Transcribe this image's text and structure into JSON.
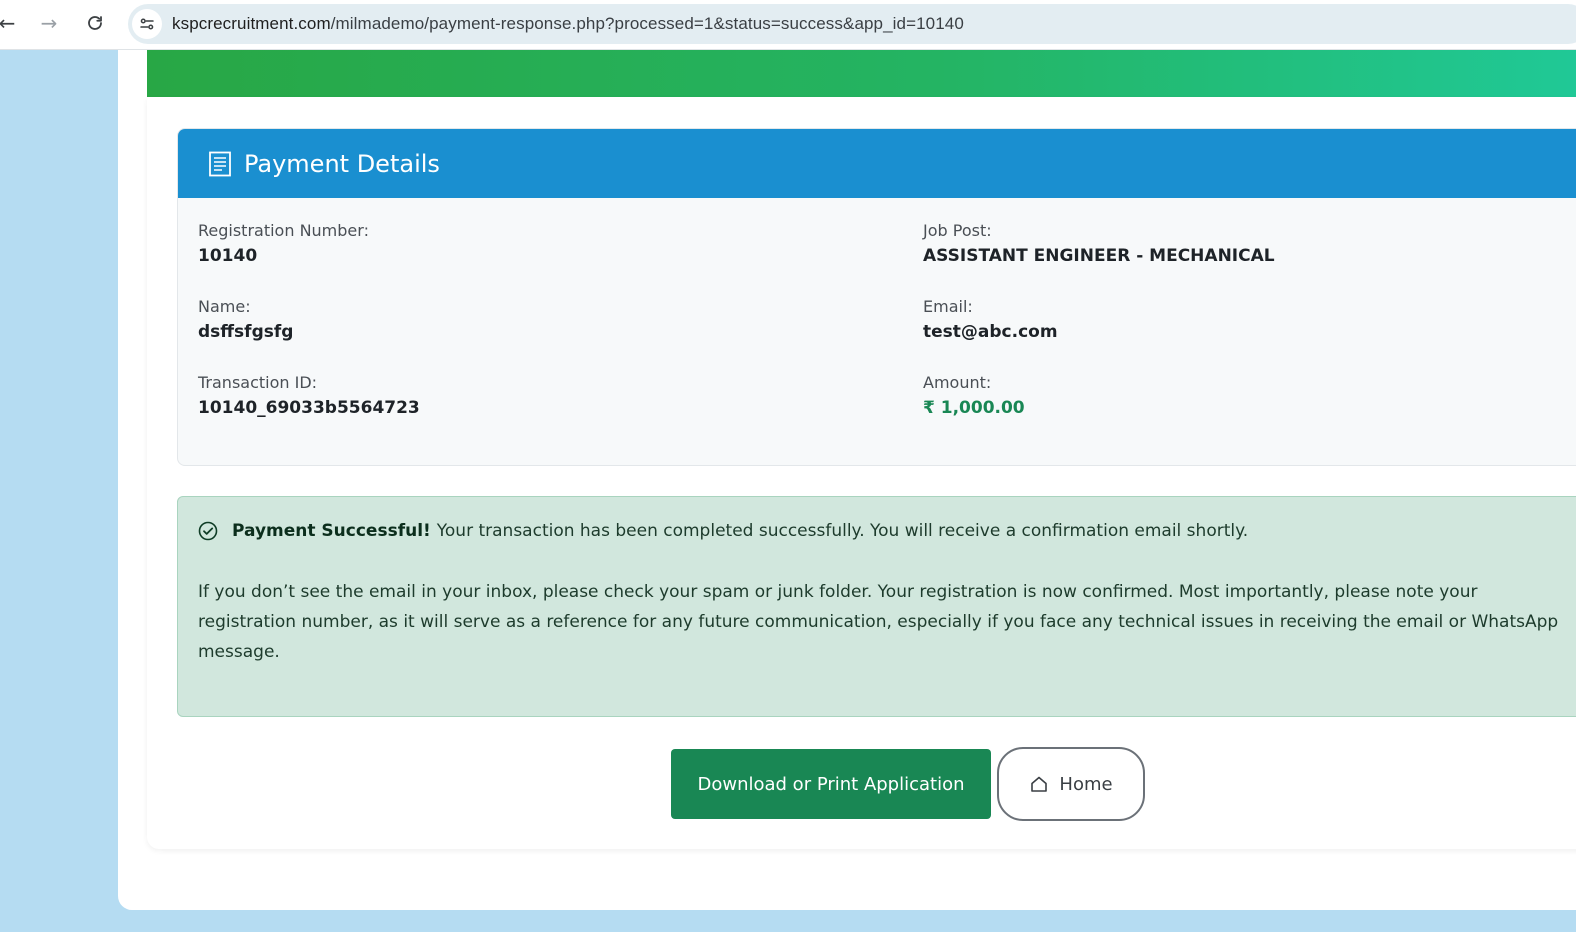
{
  "browser": {
    "url_host": "kspcrecruitment.com",
    "url_path": "/milmademo/payment-response.php?processed=1&status=success&app_id=10140"
  },
  "details": {
    "title": "Payment Details",
    "fields": {
      "registration_number": {
        "label": "Registration Number:",
        "value": "10140"
      },
      "job_post": {
        "label": "Job Post:",
        "value": "ASSISTANT ENGINEER - MECHANICAL"
      },
      "name": {
        "label": "Name:",
        "value": "dsffsfgsfg"
      },
      "email": {
        "label": "Email:",
        "value": "test@abc.com"
      },
      "transaction_id": {
        "label": "Transaction ID:",
        "value": "10140_69033b5564723"
      },
      "amount": {
        "label": "Amount:",
        "value": "₹ 1,000.00"
      }
    }
  },
  "alert": {
    "strong": "Payment Successful!",
    "text": "Your transaction has been completed successfully. You will receive a confirmation email shortly.",
    "paragraph": "If you don’t see the email in your inbox, please check your spam or junk folder. Your registration is now confirmed. Most importantly, please note your registration number, as it will serve as a reference for any future communication, especially if you face any technical issues in receiving the email or WhatsApp message."
  },
  "buttons": {
    "download_label": "Download or Print Application",
    "home_label": "Home"
  },
  "colors": {
    "header_blue": "#1a8fd0",
    "success_green": "#198754",
    "alert_bg": "#d1e7dd",
    "hero_gradient_start": "#28a745",
    "hero_gradient_end": "#20c997"
  }
}
